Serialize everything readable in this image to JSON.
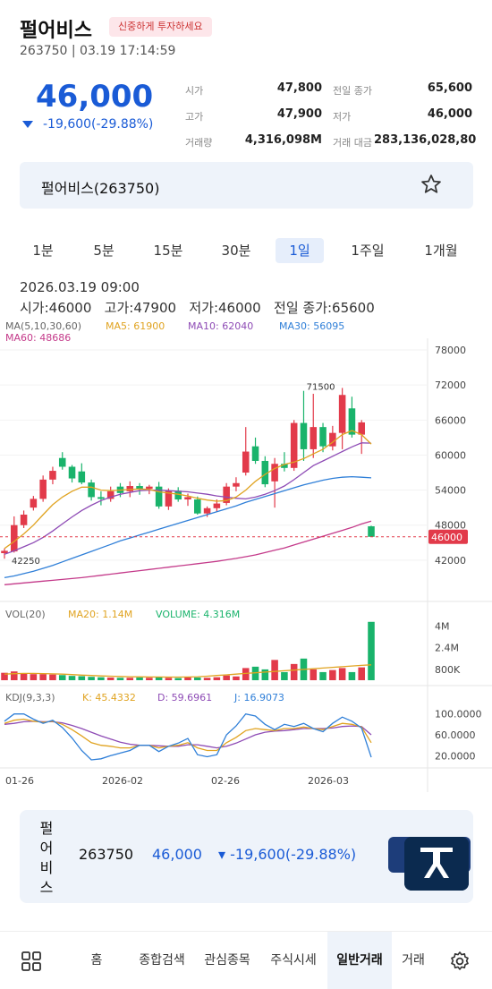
{
  "header": {
    "title": "펄어비스",
    "badge": "신중하게 투자하세요",
    "subline": "263750 | 03.19 17:14:59",
    "price": "46,000",
    "change": "-19,600(-29.88%)"
  },
  "quote": {
    "open_label": "시가",
    "open": "47,800",
    "prev_close_label": "전일 종가",
    "prev_close": "65,600",
    "high_label": "고가",
    "high": "47,900",
    "low_label": "저가",
    "low": "46,000",
    "volume_label": "거래량",
    "volume": "4,316,098M",
    "amount_label": "거래 대금",
    "amount": "283,136,028,80"
  },
  "card": {
    "name": "펄어비스(263750)",
    "icon": "star-icon"
  },
  "periods": [
    "1분",
    "5분",
    "15분",
    "30분",
    "1일",
    "1주일",
    "1개월"
  ],
  "active_period": "1일",
  "ohlc": {
    "date": "2026.03.19 09:00",
    "values": "시가:46000   고가:47900   저가:46000   전일 종가:65600"
  },
  "ma_legend": {
    "prefix": "MA(5,10,30,60)",
    "ma5": "MA5: 61900",
    "ma10": "MA10: 62040",
    "ma30": "MA30: 56095",
    "ma60": "MA60: 48686"
  },
  "vol_legend": {
    "prefix": "VOL(20)",
    "ma20": "MA20: 1.14M",
    "volume": "VOLUME: 4.316M"
  },
  "kdj_legend": {
    "prefix": "KDJ(9,3,3)",
    "k": "K: 45.4332",
    "d": "D: 59.6961",
    "j": "J: 16.9073"
  },
  "colors": {
    "up": "#e23a4a",
    "down": "#19b36b",
    "ma5": "#e0a320",
    "ma10": "#8e4bb5",
    "ma30": "#2f7fd8",
    "ma60": "#c43a8a",
    "price_line": "#e23a4a",
    "price_tag_bg": "#e23a4a"
  },
  "chart_data": [
    {
      "type": "candlestick",
      "title": "",
      "y_axis_ticks": [
        "78000",
        "72000",
        "66000",
        "60000",
        "54000",
        "48000",
        "42000"
      ],
      "ylim": [
        36000,
        80000
      ],
      "current_price_label": "46000",
      "max_label": "71500",
      "min_label": "42250",
      "x_ticks": [
        "01-26",
        "2026-02",
        "02-26",
        "2026-03"
      ],
      "candles": [
        {
          "o": 43200,
          "h": 44000,
          "l": 42250,
          "c": 43600
        },
        {
          "o": 43500,
          "h": 49500,
          "l": 43300,
          "c": 48000
        },
        {
          "o": 48000,
          "h": 50500,
          "l": 47500,
          "c": 49800
        },
        {
          "o": 51000,
          "h": 53000,
          "l": 50500,
          "c": 52500
        },
        {
          "o": 52500,
          "h": 56500,
          "l": 52000,
          "c": 55800
        },
        {
          "o": 55800,
          "h": 58000,
          "l": 55000,
          "c": 57300
        },
        {
          "o": 59500,
          "h": 60500,
          "l": 57500,
          "c": 58000
        },
        {
          "o": 58000,
          "h": 58300,
          "l": 55300,
          "c": 56000
        },
        {
          "o": 57200,
          "h": 58600,
          "l": 55000,
          "c": 55300
        },
        {
          "o": 55300,
          "h": 55800,
          "l": 52200,
          "c": 52800
        },
        {
          "o": 52800,
          "h": 53800,
          "l": 51400,
          "c": 52500
        },
        {
          "o": 52500,
          "h": 54600,
          "l": 52000,
          "c": 53800
        },
        {
          "o": 54600,
          "h": 55200,
          "l": 52800,
          "c": 53500
        },
        {
          "o": 53800,
          "h": 55500,
          "l": 52800,
          "c": 54700
        },
        {
          "o": 54700,
          "h": 55200,
          "l": 53200,
          "c": 54200
        },
        {
          "o": 54200,
          "h": 54900,
          "l": 53300,
          "c": 54600
        },
        {
          "o": 54600,
          "h": 55400,
          "l": 50800,
          "c": 51200
        },
        {
          "o": 51200,
          "h": 54300,
          "l": 50600,
          "c": 53900
        },
        {
          "o": 53900,
          "h": 54500,
          "l": 52000,
          "c": 52400
        },
        {
          "o": 52400,
          "h": 53400,
          "l": 51300,
          "c": 52800
        },
        {
          "o": 52400,
          "h": 52900,
          "l": 49800,
          "c": 50000
        },
        {
          "o": 50000,
          "h": 51200,
          "l": 49400,
          "c": 50900
        },
        {
          "o": 50900,
          "h": 52400,
          "l": 50300,
          "c": 51700
        },
        {
          "o": 51800,
          "h": 55200,
          "l": 51400,
          "c": 54600
        },
        {
          "o": 54600,
          "h": 56200,
          "l": 53800,
          "c": 55200
        },
        {
          "o": 57000,
          "h": 64800,
          "l": 56500,
          "c": 60600
        },
        {
          "o": 61500,
          "h": 63000,
          "l": 58500,
          "c": 59000
        },
        {
          "o": 59000,
          "h": 59800,
          "l": 54500,
          "c": 55000
        },
        {
          "o": 55500,
          "h": 59500,
          "l": 51000,
          "c": 58500
        },
        {
          "o": 58500,
          "h": 60500,
          "l": 57200,
          "c": 57800
        },
        {
          "o": 57800,
          "h": 66000,
          "l": 57300,
          "c": 65500
        },
        {
          "o": 65500,
          "h": 71000,
          "l": 59000,
          "c": 61000
        },
        {
          "o": 61000,
          "h": 70500,
          "l": 59500,
          "c": 64800
        },
        {
          "o": 64800,
          "h": 65500,
          "l": 60500,
          "c": 61500
        },
        {
          "o": 61500,
          "h": 65000,
          "l": 60800,
          "c": 63800
        },
        {
          "o": 63800,
          "h": 71500,
          "l": 61000,
          "c": 70300
        },
        {
          "o": 68000,
          "h": 70000,
          "l": 63000,
          "c": 63500
        },
        {
          "o": 63500,
          "h": 66000,
          "l": 60200,
          "c": 65600
        },
        {
          "o": 47800,
          "h": 47900,
          "l": 46000,
          "c": 46000
        }
      ],
      "ma5": [
        44000,
        45200,
        46500,
        48000,
        49800,
        51500,
        52800,
        53800,
        54500,
        54500,
        54000,
        53900,
        54000,
        54100,
        54200,
        54100,
        53700,
        53500,
        53300,
        53000,
        52600,
        52300,
        52100,
        52200,
        52800,
        54000,
        55500,
        56700,
        57700,
        58400,
        58800,
        59400,
        60200,
        61000,
        62200,
        63500,
        64200,
        63500,
        61900
      ],
      "ma10": [
        43000,
        43600,
        44300,
        45000,
        45900,
        47000,
        48200,
        49400,
        50500,
        51400,
        52200,
        52800,
        53300,
        53600,
        53900,
        54000,
        54000,
        53900,
        53800,
        53700,
        53500,
        53300,
        53000,
        52800,
        52600,
        52500,
        52800,
        53300,
        53900,
        54700,
        55800,
        57000,
        58200,
        59000,
        59800,
        60600,
        61400,
        62100,
        62040
      ],
      "ma30": [
        39000,
        39300,
        39700,
        40100,
        40600,
        41100,
        41700,
        42300,
        42900,
        43500,
        44100,
        44700,
        45300,
        45800,
        46300,
        46800,
        47300,
        47800,
        48300,
        48800,
        49300,
        49800,
        50300,
        50800,
        51300,
        51900,
        52400,
        52900,
        53400,
        53900,
        54400,
        54900,
        55300,
        55700,
        56000,
        56200,
        56300,
        56200,
        56095
      ],
      "ma60": [
        37800,
        37950,
        38100,
        38250,
        38400,
        38550,
        38700,
        38850,
        39000,
        39200,
        39400,
        39600,
        39800,
        40000,
        40200,
        40400,
        40600,
        40800,
        41000,
        41200,
        41400,
        41600,
        41800,
        42050,
        42300,
        42600,
        42900,
        43300,
        43700,
        44100,
        44600,
        45100,
        45600,
        46100,
        46600,
        47100,
        47600,
        48200,
        48686
      ]
    },
    {
      "type": "bar",
      "title": "VOL(20)",
      "y_axis_ticks": [
        "4M",
        "2.4M",
        "800K"
      ],
      "ylim": [
        0,
        4.5
      ],
      "unit": "M",
      "values": [
        0.55,
        0.65,
        0.5,
        0.45,
        0.45,
        0.42,
        0.38,
        0.32,
        0.3,
        0.25,
        0.22,
        0.2,
        0.18,
        0.18,
        0.2,
        0.18,
        0.22,
        0.18,
        0.16,
        0.2,
        0.2,
        0.18,
        0.22,
        0.35,
        0.28,
        0.9,
        1.0,
        0.8,
        1.5,
        0.6,
        1.2,
        1.6,
        0.8,
        0.6,
        0.75,
        0.9,
        0.6,
        0.95,
        4.316
      ],
      "up": [
        true,
        true,
        true,
        true,
        true,
        true,
        false,
        false,
        false,
        false,
        false,
        true,
        false,
        true,
        false,
        true,
        false,
        true,
        false,
        true,
        false,
        true,
        true,
        true,
        true,
        true,
        false,
        false,
        true,
        false,
        true,
        false,
        true,
        false,
        true,
        true,
        false,
        true,
        false
      ],
      "ma20": [
        0.45,
        0.48,
        0.5,
        0.5,
        0.49,
        0.47,
        0.45,
        0.42,
        0.38,
        0.35,
        0.32,
        0.3,
        0.28,
        0.26,
        0.25,
        0.24,
        0.24,
        0.23,
        0.23,
        0.24,
        0.26,
        0.3,
        0.35,
        0.4,
        0.45,
        0.5,
        0.55,
        0.6,
        0.65,
        0.7,
        0.75,
        0.8,
        0.85,
        0.9,
        0.95,
        1.0,
        1.05,
        1.1,
        1.14
      ]
    },
    {
      "type": "line",
      "title": "KDJ(9,3,3)",
      "y_axis_ticks": [
        "100.0000",
        "60.0000",
        "20.0000"
      ],
      "ylim": [
        0,
        120
      ],
      "k": [
        82,
        88,
        90,
        86,
        84,
        86,
        80,
        70,
        58,
        45,
        40,
        38,
        35,
        35,
        40,
        40,
        35,
        38,
        40,
        45,
        35,
        30,
        30,
        45,
        55,
        68,
        72,
        70,
        68,
        72,
        72,
        75,
        72,
        70,
        76,
        82,
        80,
        75,
        45
      ],
      "d": [
        80,
        82,
        85,
        86,
        85,
        85,
        83,
        78,
        72,
        65,
        58,
        52,
        46,
        42,
        40,
        40,
        39,
        38,
        38,
        41,
        41,
        38,
        35,
        38,
        44,
        52,
        60,
        65,
        67,
        68,
        70,
        72,
        72,
        72,
        73,
        76,
        77,
        76,
        60
      ],
      "j": [
        86,
        100,
        100,
        90,
        82,
        88,
        74,
        54,
        30,
        12,
        14,
        20,
        25,
        30,
        40,
        40,
        28,
        38,
        44,
        53,
        22,
        18,
        22,
        60,
        77,
        100,
        96,
        80,
        70,
        80,
        76,
        82,
        72,
        66,
        82,
        94,
        86,
        73,
        17
      ]
    }
  ],
  "strip": {
    "name": "펄어비스",
    "code": "263750",
    "price": "46,000",
    "change": "▾ -19,600(-29.88%)"
  },
  "nav": {
    "menu_icon": "grid-icon",
    "items": [
      "홈",
      "종합검색",
      "관심종목",
      "주식시세",
      "일반거래",
      "거래"
    ],
    "active": "일반거래",
    "settings_icon": "gear-icon"
  }
}
